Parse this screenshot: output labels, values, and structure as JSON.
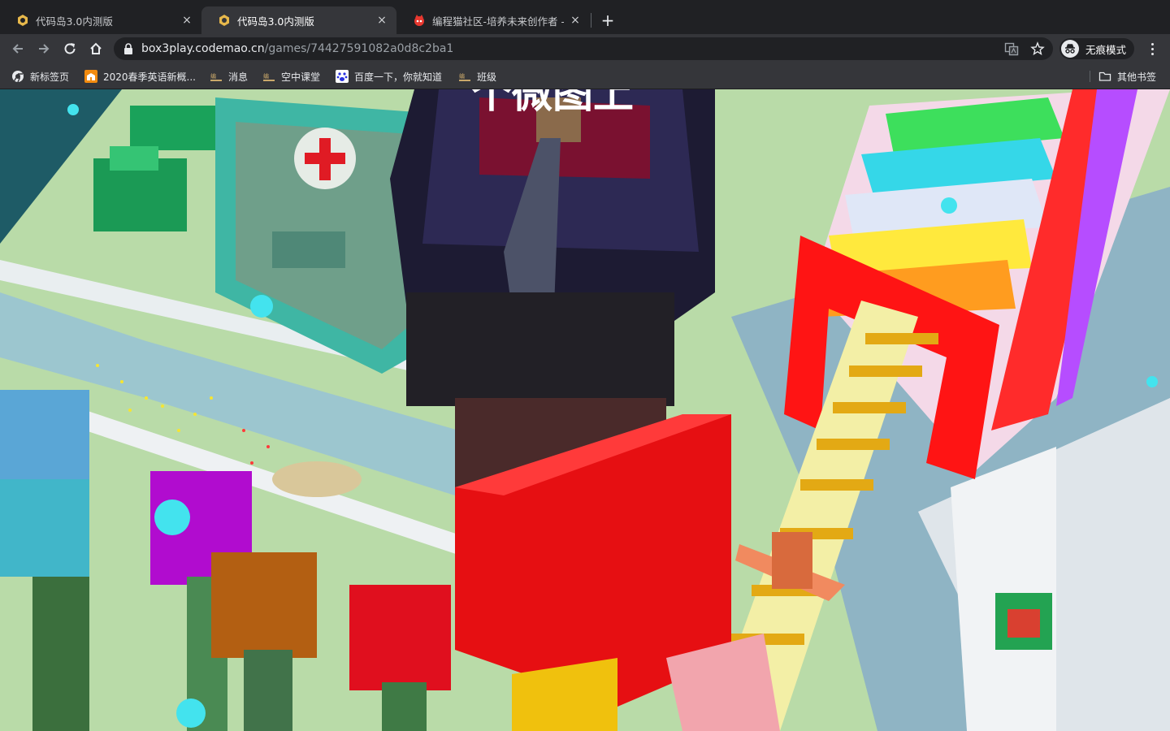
{
  "tabs": [
    {
      "title": "代码岛3.0内测版",
      "active": false
    },
    {
      "title": "代码岛3.0内测版",
      "active": true
    },
    {
      "title": "编程猫社区-培养未来创作者 - 编",
      "active": false
    }
  ],
  "tab_close_icon": "×",
  "new_tab_icon": "+",
  "address_bar": {
    "host": "box3play.codemao.cn",
    "path": "/games/74427591082a0d8c2ba1"
  },
  "profile": {
    "label": "无痕模式"
  },
  "bookmarks": [
    {
      "label": "新标签页",
      "icon": "chrome-icon"
    },
    {
      "label": "2020春季英语新概...",
      "icon": "school-icon"
    },
    {
      "label": "消息",
      "icon": "codemao-icon"
    },
    {
      "label": "空中课堂",
      "icon": "codemao-icon"
    },
    {
      "label": "百度一下，你就知道",
      "icon": "baidu-icon"
    },
    {
      "label": "班级",
      "icon": "codemao-icon"
    }
  ],
  "other_bookmarks": {
    "label": "其他书签",
    "icon": "folder-icon"
  },
  "game": {
    "banner_text": "个微图上",
    "colors": {
      "grass": "#b5d9a2",
      "water": "#8fb9c9",
      "red": "#e60f12",
      "rainbow": [
        "#ff2b2b",
        "#ff9c1f",
        "#ffe93d",
        "#3ddf5c",
        "#35d7e8",
        "#f3a9d6"
      ]
    }
  }
}
